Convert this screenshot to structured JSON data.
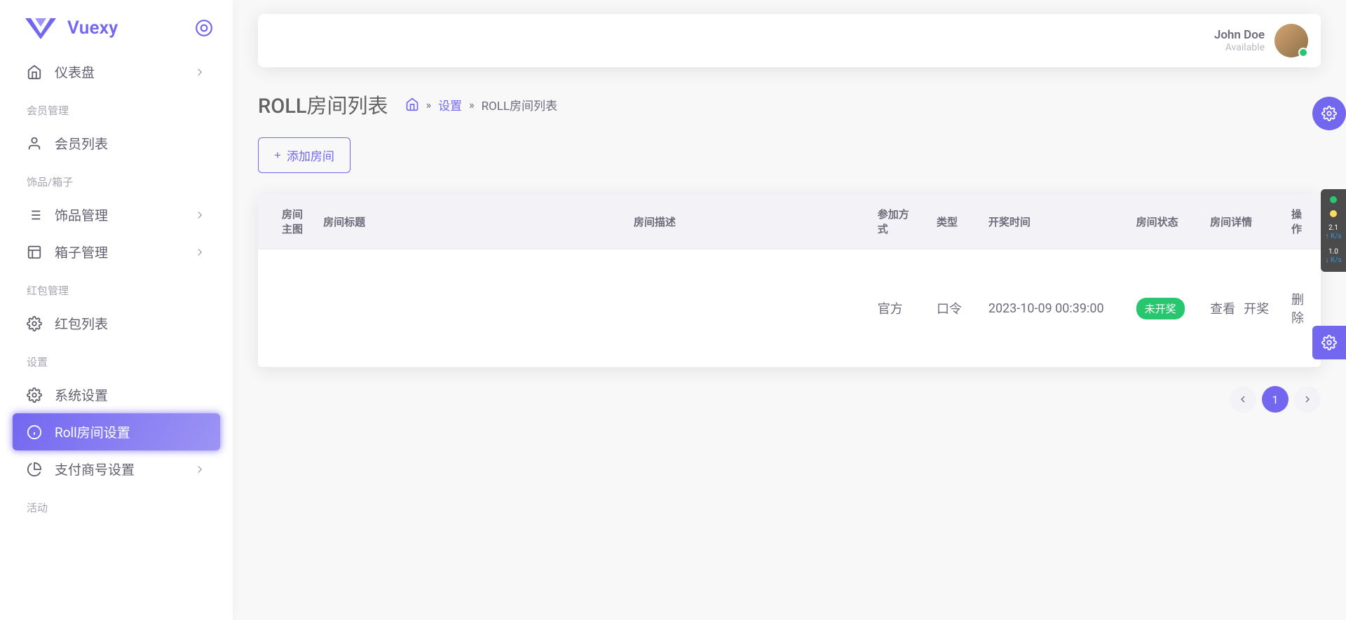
{
  "brand": "Vuexy",
  "user": {
    "name": "John Doe",
    "status": "Available"
  },
  "sidebar": {
    "dashboard": "仪表盘",
    "sections": [
      {
        "title": "会员管理",
        "items": [
          {
            "label": "会员列表"
          }
        ]
      },
      {
        "title": "饰品/箱子",
        "items": [
          {
            "label": "饰品管理",
            "chevron": true
          },
          {
            "label": "箱子管理",
            "chevron": true
          }
        ]
      },
      {
        "title": "红包管理",
        "items": [
          {
            "label": "红包列表"
          }
        ]
      },
      {
        "title": "设置",
        "items": [
          {
            "label": "系统设置"
          },
          {
            "label": "Roll房间设置",
            "active": true
          },
          {
            "label": "支付商号设置",
            "chevron": true
          }
        ]
      },
      {
        "title": "活动",
        "items": []
      }
    ]
  },
  "page": {
    "title": "ROLL房间列表",
    "breadcrumb": {
      "settings": "设置",
      "current": "ROLL房间列表"
    },
    "add_button": "添加房间"
  },
  "table": {
    "headers": [
      "房间主图",
      "房间标题",
      "房间描述",
      "参加方式",
      "类型",
      "开奖时间",
      "房间状态",
      "房间详情",
      "操作"
    ],
    "rows": [
      {
        "join_mode": "官方",
        "type": "口令",
        "draw_time": "2023-10-09 00:39:00",
        "status": "未开奖",
        "actions": [
          "查看",
          "开奖",
          "删除"
        ]
      }
    ]
  },
  "pagination": {
    "current": "1"
  },
  "widget": {
    "s1": "2.1",
    "s2": "1.0",
    "unit": "K/s"
  }
}
